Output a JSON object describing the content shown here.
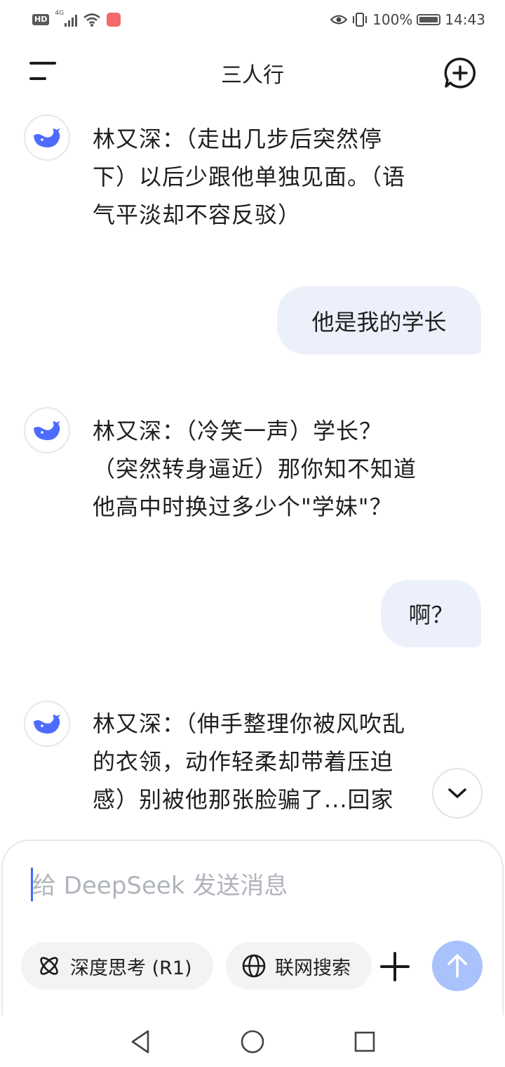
{
  "status_bar": {
    "hd": "HD",
    "network": "4G",
    "battery": "100%",
    "time": "14:43"
  },
  "header": {
    "title": "三人行"
  },
  "messages": [
    {
      "role": "assistant",
      "lines": [
        "林又深：（走出几步后突然停",
        "下）以后少跟他单独见面。（语",
        "气平淡却不容反驳）"
      ]
    },
    {
      "role": "user",
      "text": "他是我的学长"
    },
    {
      "role": "assistant",
      "lines": [
        "林又深：（冷笑一声）学长？",
        "（突然转身逼近）那你知不知道",
        "他高中时换过多少个\"学妹\"？"
      ]
    },
    {
      "role": "user",
      "text": "啊？"
    },
    {
      "role": "assistant",
      "lines": [
        "林又深：（伸手整理你被风吹乱",
        "的衣领，动作轻柔却带着压迫",
        "感）别被他那张脸骗了...回家"
      ]
    }
  ],
  "composer": {
    "placeholder": "给 DeepSeek 发送消息",
    "deep_think_label": "深度思考 (R1)",
    "web_search_label": "联网搜索"
  },
  "colors": {
    "accent": "#4d6bfe",
    "user_bubble": "#ecf0fb",
    "send_button": "#a9c2fb"
  }
}
